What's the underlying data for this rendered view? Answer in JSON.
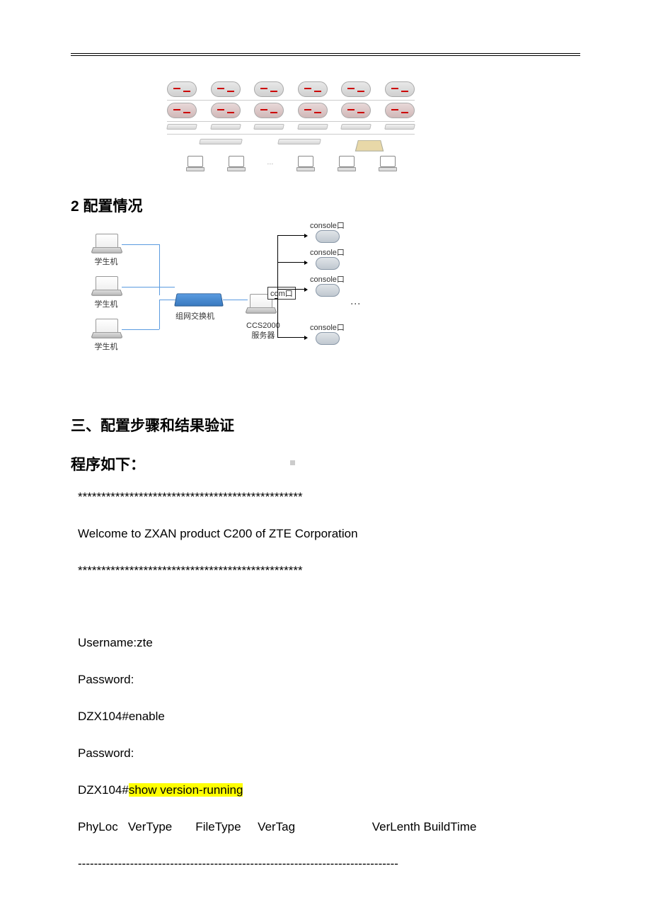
{
  "headings": {
    "config": "2 配置情况",
    "steps": "三、配置步骤和结果验证",
    "program": "程序如下："
  },
  "config_diagram": {
    "student_pc": "学生机",
    "switch": "组网交换机",
    "server": "CCS2000\n服务器",
    "console": "console口",
    "com": "com口"
  },
  "terminal": {
    "sep1": "************************************************",
    "welcome": "Welcome to ZXAN product C200 of ZTE Corporation",
    "sep2": "************************************************",
    "username_line": "Username:zte",
    "password1": "Password:",
    "enable_line": "DZX104#enable",
    "password2": "Password:",
    "show_version_prefix": "DZX104#",
    "show_version_cmd": "show version-running",
    "headers": "PhyLoc   VerType       FileType     VerTag                       VerLenth BuildTime",
    "dashline": "--------------------------------------------------------------------------------"
  }
}
